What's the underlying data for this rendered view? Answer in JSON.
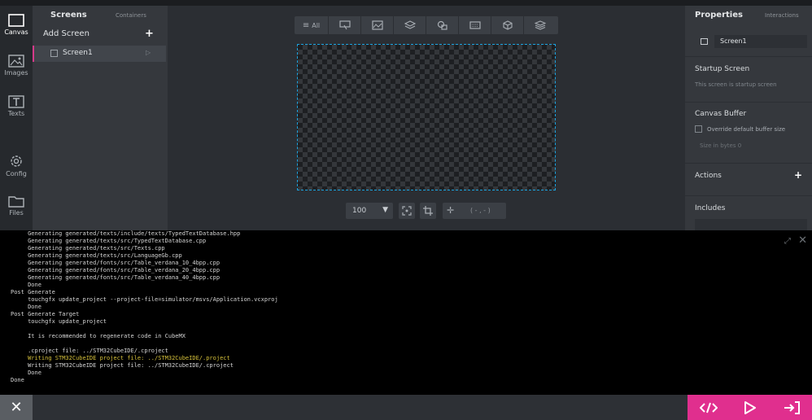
{
  "rail": {
    "items": [
      {
        "label": "Canvas",
        "icon": "canvas-icon",
        "active": true
      },
      {
        "label": "Images",
        "icon": "images-icon"
      },
      {
        "label": "Texts",
        "icon": "texts-icon"
      },
      {
        "label": "Config",
        "icon": "gear-icon"
      },
      {
        "label": "Files",
        "icon": "folder-icon"
      }
    ]
  },
  "screens": {
    "tab_screens": "Screens",
    "tab_containers": "Containers",
    "add_label": "Add Screen",
    "add_icon": "+",
    "list": [
      {
        "label": "Screen1"
      }
    ]
  },
  "toolbar": {
    "all_label": "All",
    "buttons": [
      "widget-icon",
      "image-icon",
      "layers-icon",
      "shapes-icon",
      "keyboard-icon",
      "cube-icon",
      "stack-icon"
    ]
  },
  "zoom": {
    "value": "100",
    "coord": "( - , - )"
  },
  "properties": {
    "title": "Properties",
    "interactions": "Interactions",
    "screen_name": "Screen1",
    "startup_title": "Startup Screen",
    "startup_sub": "This screen is startup screen",
    "buffer_title": "Canvas Buffer",
    "buffer_override": "Override default buffer size",
    "buffer_size": "Size in bytes   0",
    "actions_title": "Actions",
    "includes_title": "Includes"
  },
  "console": {
    "lines": [
      {
        "text": "     Generating generated/texts/include/texts/TypedTextDatabase.hpp"
      },
      {
        "text": "     Generating generated/texts/src/TypedTextDatabase.cpp"
      },
      {
        "text": "     Generating generated/texts/src/Texts.cpp"
      },
      {
        "text": "     Generating generated/texts/src/LanguageGb.cpp"
      },
      {
        "text": "     Generating generated/fonts/src/Table_verdana_10_4bpp.cpp"
      },
      {
        "text": "     Generating generated/fonts/src/Table_verdana_20_4bpp.cpp"
      },
      {
        "text": "     Generating generated/fonts/src/Table_verdana_40_4bpp.cpp"
      },
      {
        "text": "     Done"
      },
      {
        "text": "Post Generate"
      },
      {
        "text": "     touchgfx update_project --project-file=simulator/msvs/Application.vcxproj"
      },
      {
        "text": "     Done"
      },
      {
        "text": "Post Generate Target"
      },
      {
        "text": "     touchgfx update_project"
      },
      {
        "text": ""
      },
      {
        "text": "     It is recommended to regenerate code in CubeMX"
      },
      {
        "text": ""
      },
      {
        "text": "     .cproject file: ../STM32CubeIDE/.cproject"
      },
      {
        "text": "     Writing STM32CubeIDE project file: ../STM32CubeIDE/.project",
        "color": "yellow"
      },
      {
        "text": "     Writing STM32CubeIDE project file: ../STM32CubeIDE/.cproject"
      },
      {
        "text": "     Done"
      },
      {
        "text": "Done"
      }
    ]
  },
  "bottom": {
    "close_icon": "close-icon",
    "actions": [
      "code-icon",
      "play-icon",
      "export-icon"
    ]
  },
  "colors": {
    "accent": "#e02f8e",
    "selection": "#1aa3e0",
    "console_warn": "#d6c13a"
  }
}
